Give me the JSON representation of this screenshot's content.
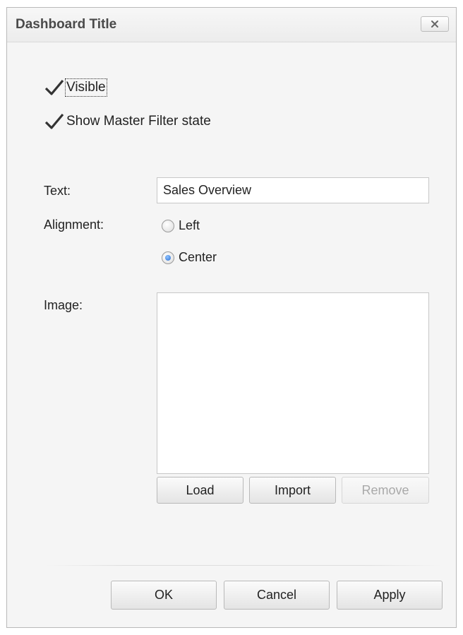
{
  "dialog": {
    "title": "Dashboard Title",
    "close_icon": "close-icon"
  },
  "options": {
    "visible": {
      "label": "Visible",
      "checked": true
    },
    "show_master_filter": {
      "label": "Show Master Filter state",
      "checked": true
    }
  },
  "text_field": {
    "label": "Text:",
    "value": "Sales Overview"
  },
  "alignment": {
    "label": "Alignment:",
    "options": [
      {
        "label": "Left",
        "selected": false
      },
      {
        "label": "Center",
        "selected": true
      }
    ]
  },
  "image": {
    "label": "Image:",
    "load_label": "Load",
    "import_label": "Import",
    "remove_label": "Remove",
    "remove_enabled": false
  },
  "footer": {
    "ok_label": "OK",
    "cancel_label": "Cancel",
    "apply_label": "Apply"
  },
  "colors": {
    "radio_accent": "#2c6fd1",
    "disabled_text": "#a9a9a9"
  }
}
